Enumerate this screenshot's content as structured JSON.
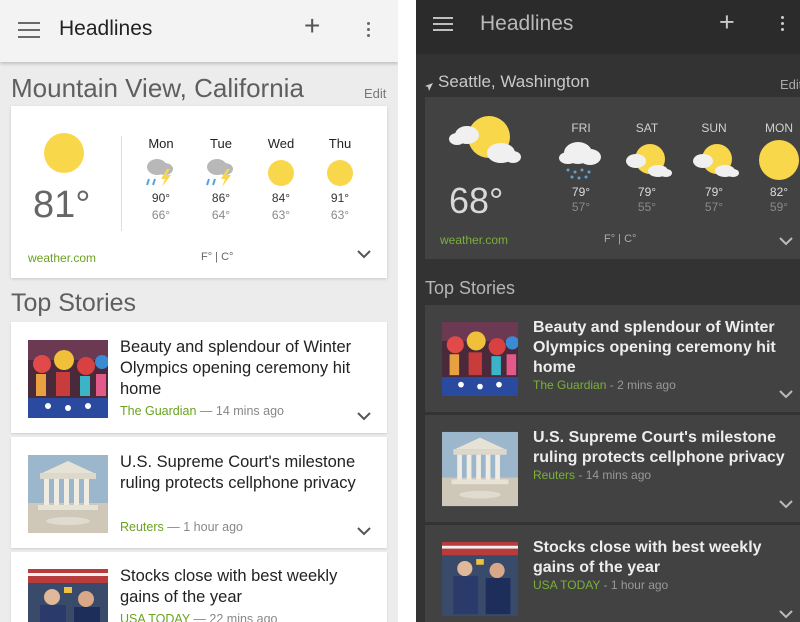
{
  "light": {
    "app_title": "Headlines",
    "location": "Mountain View, California",
    "edit_label": "Edit",
    "weather": {
      "current_temp": "81°",
      "source": "weather.com",
      "units": "F° | C°",
      "forecast": [
        {
          "day": "Mon",
          "high": "90°",
          "low": "66°",
          "icon": "thunderstorm"
        },
        {
          "day": "Tue",
          "high": "86°",
          "low": "64°",
          "icon": "thunderstorm"
        },
        {
          "day": "Wed",
          "high": "84°",
          "low": "63°",
          "icon": "sunny"
        },
        {
          "day": "Thu",
          "high": "91°",
          "low": "63°",
          "icon": "sunny"
        }
      ]
    },
    "top_stories_label": "Top Stories",
    "stories": [
      {
        "headline": "Beauty and splendour of Winter Olympics opening ceremony hit home",
        "source": "The Guardian",
        "time": "14 mins ago"
      },
      {
        "headline": "U.S. Supreme Court's milestone ruling protects cellphone privacy",
        "source": "Reuters",
        "time": "1 hour ago"
      },
      {
        "headline": "Stocks close with best weekly gains of the year",
        "source": "USA TODAY",
        "time": "22 mins ago"
      }
    ]
  },
  "dark": {
    "app_title": "Headlines",
    "location": "Seattle, Washington",
    "edit_label": "Edit",
    "weather": {
      "current_temp": "68°",
      "source": "weather.com",
      "units": "F° | C°",
      "forecast": [
        {
          "day": "FRI",
          "high": "79°",
          "low": "57°",
          "icon": "rain"
        },
        {
          "day": "SAT",
          "high": "79°",
          "low": "55°",
          "icon": "partly-cloudy"
        },
        {
          "day": "SUN",
          "high": "79°",
          "low": "57°",
          "icon": "partly-cloudy"
        },
        {
          "day": "MON",
          "high": "82°",
          "low": "59°",
          "icon": "sunny"
        }
      ]
    },
    "top_stories_label": "Top Stories",
    "stories": [
      {
        "headline": "Beauty and splendour of Winter Olympics opening ceremony hit home",
        "source": "The Guardian",
        "time": "2 mins ago"
      },
      {
        "headline": "U.S. Supreme Court's milestone ruling protects cellphone privacy",
        "source": "Reuters",
        "time": "14 mins ago"
      },
      {
        "headline": "Stocks close with best weekly gains of the year",
        "source": "USA TODAY",
        "time": "1 hour ago"
      }
    ]
  },
  "colors": {
    "accent_green": "#6aa21f",
    "sun_yellow": "#f9d74b",
    "dark_bg": "#333333"
  }
}
